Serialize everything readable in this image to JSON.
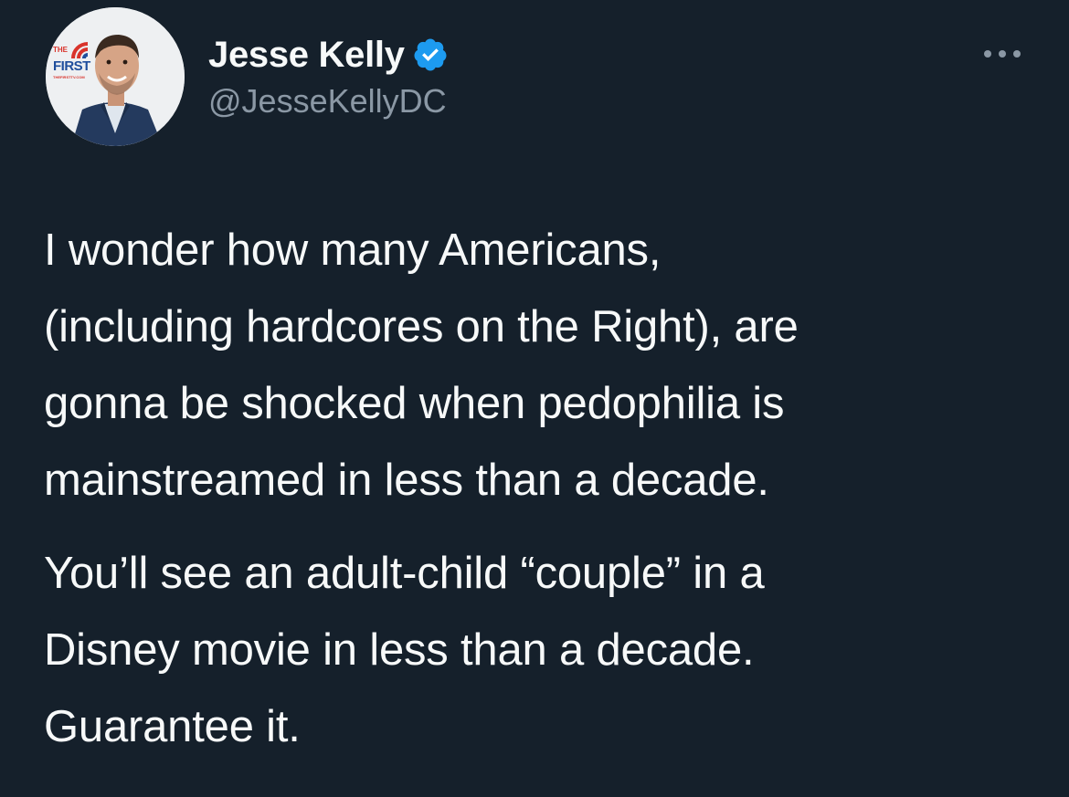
{
  "tweet": {
    "display_name": "Jesse Kelly",
    "handle": "@JesseKellyDC",
    "verified": true,
    "avatar_badge": {
      "line1": "THE",
      "line2": "FIRST",
      "line3": "THEFIRSTTV.COM"
    },
    "more_icon": "more-horizontal-icon",
    "paragraphs": [
      {
        "lines": [
          "I wonder how many Americans,",
          "(including hardcores on the Right), are",
          "gonna be shocked when pedophilia is",
          "mainstreamed in less than a decade."
        ]
      },
      {
        "lines": [
          "You’ll see an adult-child “couple” in a",
          "Disney movie in less than a decade.",
          "Guarantee it."
        ]
      }
    ]
  },
  "colors": {
    "background": "#15202b",
    "text": "#f7f9f9",
    "secondary": "#8b98a5",
    "verified": "#1d9bf0"
  }
}
